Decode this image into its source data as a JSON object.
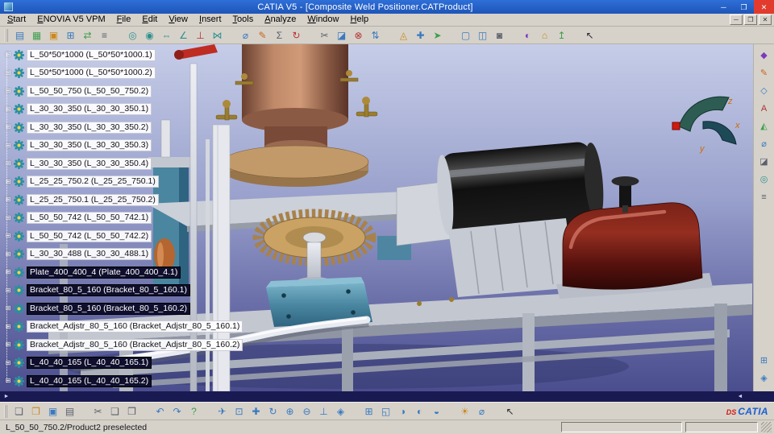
{
  "colors": {
    "titlebar": "#2f6fd8",
    "titlebar-deep": "#1e55b8",
    "close-red": "#e23b2e",
    "chrome": "#d6d2ca",
    "selection-bg": "#0f0f2d",
    "strip-navy": "#1a1a52",
    "logo-blue": "#1a5fd0",
    "logo-red": "#cf1a10",
    "viewport-top": "#c6cde8",
    "viewport-bottom": "#4a4e8e",
    "gear-tan": "#c9a264",
    "mount-teal": "#4a86a0",
    "housing-maroon": "#6b1d17",
    "motor-black": "#141414"
  },
  "window": {
    "title": "CATIA V5 - [Composite Weld Positioner.CATProduct]",
    "controls": [
      {
        "name": "minimize-button",
        "glyph": "─",
        "close": false
      },
      {
        "name": "maximize-button",
        "glyph": "❐",
        "close": false
      },
      {
        "name": "close-button",
        "glyph": "✕",
        "close": true
      }
    ]
  },
  "menu": {
    "items": [
      {
        "name": "menu-start",
        "label": "Start"
      },
      {
        "name": "menu-enovia-v5-vpm",
        "label": "ENOVIA V5 VPM"
      },
      {
        "name": "menu-file",
        "label": "File"
      },
      {
        "name": "menu-edit",
        "label": "Edit"
      },
      {
        "name": "menu-view",
        "label": "View"
      },
      {
        "name": "menu-insert",
        "label": "Insert"
      },
      {
        "name": "menu-tools",
        "label": "Tools"
      },
      {
        "name": "menu-analyze",
        "label": "Analyze"
      },
      {
        "name": "menu-window",
        "label": "Window"
      },
      {
        "name": "menu-help",
        "label": "Help"
      }
    ],
    "doc_controls": [
      {
        "name": "doc-minimize-button",
        "glyph": "─"
      },
      {
        "name": "doc-restore-button",
        "glyph": "❐"
      },
      {
        "name": "doc-close-button",
        "glyph": "✕"
      }
    ]
  },
  "toolbar_top": {
    "icons": [
      {
        "name": "new-component-icon",
        "glyph": "▤",
        "color": "#3a7abe"
      },
      {
        "name": "new-product-icon",
        "glyph": "▦",
        "color": "#3f9e4d"
      },
      {
        "name": "new-part-icon",
        "glyph": "▣",
        "color": "#c9891e"
      },
      {
        "name": "existing-component-icon",
        "glyph": "⊞",
        "color": "#3a7abe"
      },
      {
        "name": "replace-component-icon",
        "glyph": "⇄",
        "color": "#3f9e4d"
      },
      {
        "name": "graph-tree-reorder-icon",
        "glyph": "≡",
        "color": "#5a5f6a"
      },
      {
        "name": "coincidence-constraint-icon",
        "glyph": "◎",
        "color": "#2f8f8f",
        "gap": true
      },
      {
        "name": "contact-constraint-icon",
        "glyph": "◉",
        "color": "#2f8f8f"
      },
      {
        "name": "offset-constraint-icon",
        "glyph": "⇔",
        "color": "#2f8f8f"
      },
      {
        "name": "angle-constraint-icon",
        "glyph": "∠",
        "color": "#2f8f8f"
      },
      {
        "name": "fix-component-icon",
        "glyph": "⊥",
        "color": "#b03030"
      },
      {
        "name": "fix-together-icon",
        "glyph": "⋈",
        "color": "#2f8f8f"
      },
      {
        "name": "measure-between-icon",
        "glyph": "⌀",
        "color": "#3a7abe",
        "gap": true
      },
      {
        "name": "measure-item-icon",
        "glyph": "✎",
        "color": "#c9651e"
      },
      {
        "name": "mass-properties-icon",
        "glyph": "Σ",
        "color": "#5a5f6a"
      },
      {
        "name": "update-all-icon",
        "glyph": "↻",
        "color": "#c03030"
      },
      {
        "name": "trim-cut-icon",
        "glyph": "✂",
        "color": "#5a5f6a",
        "gap": true
      },
      {
        "name": "sectioning-icon",
        "glyph": "◪",
        "color": "#3a7abe"
      },
      {
        "name": "clash-analysis-icon",
        "glyph": "⊗",
        "color": "#b03030"
      },
      {
        "name": "distance-band-icon",
        "glyph": "⇅",
        "color": "#3a7abe"
      },
      {
        "name": "explode-view-icon",
        "glyph": "◬",
        "color": "#c9891e",
        "gap": true
      },
      {
        "name": "manipulate-icon",
        "glyph": "✚",
        "color": "#3a7abe"
      },
      {
        "name": "smart-move-icon",
        "glyph": "➤",
        "color": "#3f9e4d"
      },
      {
        "name": "new-window-icon",
        "glyph": "▢",
        "color": "#3a7abe",
        "gap": true
      },
      {
        "name": "tile-window-icon",
        "glyph": "◫",
        "color": "#3a7abe"
      },
      {
        "name": "capture-image-icon",
        "glyph": "◙",
        "color": "#5a5f6a"
      },
      {
        "name": "render-style-icon",
        "glyph": "◐",
        "color": "#7a3abe",
        "gap": true
      },
      {
        "name": "catalog-browser-icon",
        "glyph": "⌂",
        "color": "#c9891e"
      },
      {
        "name": "publish-icon",
        "glyph": "↥",
        "color": "#3f9e4d"
      },
      {
        "name": "selector-icon",
        "glyph": "↖",
        "color": "#2a2a2a",
        "gap": true
      }
    ]
  },
  "tree": {
    "branch_glyph": "⊞",
    "items": [
      {
        "label": "L_50*50*1000 (L_50*50*1000.1)",
        "selected": false
      },
      {
        "label": "L_50*50*1000 (L_50*50*1000.2)",
        "selected": false
      },
      {
        "label": "L_50_50_750 (L_50_50_750.2)",
        "selected": false
      },
      {
        "label": "L_30_30_350 (L_30_30_350.1)",
        "selected": false
      },
      {
        "label": "L_30_30_350 (L_30_30_350.2)",
        "selected": false
      },
      {
        "label": "L_30_30_350 (L_30_30_350.3)",
        "selected": false
      },
      {
        "label": "L_30_30_350 (L_30_30_350.4)",
        "selected": false
      },
      {
        "label": "L_25_25_750.2 (L_25_25_750.1)",
        "selected": false
      },
      {
        "label": "L_25_25_750.1 (L_25_25_750.2)",
        "selected": false
      },
      {
        "label": "L_50_50_742 (L_50_50_742.1)",
        "selected": false
      },
      {
        "label": "L_50_50_742 (L_50_50_742.2)",
        "selected": false
      },
      {
        "label": "L_30_30_488 (L_30_30_488.1)",
        "selected": false
      },
      {
        "label": "Plate_400_400_4 (Plate_400_400_4.1)",
        "selected": true
      },
      {
        "label": "Bracket_80_5_160 (Bracket_80_5_160.1)",
        "selected": true
      },
      {
        "label": "Bracket_80_5_160 (Bracket_80_5_160.2)",
        "selected": true
      },
      {
        "label": "Bracket_Adjstr_80_5_160 (Bracket_Adjstr_80_5_160.1)",
        "selected": false
      },
      {
        "label": "Bracket_Adjstr_80_5_160 (Bracket_Adjstr_80_5_160.2)",
        "selected": false
      },
      {
        "label": "L_40_40_165 (L_40_40_165.1)",
        "selected": true
      },
      {
        "label": "L_40_40_165 (L_40_40_165.2)",
        "selected": true
      }
    ]
  },
  "viewport": {
    "compass_labels": {
      "x": "x",
      "y": "y",
      "z": "z"
    }
  },
  "toolbar_right": {
    "top": [
      {
        "name": "enovia-icon",
        "glyph": "◆",
        "color": "#7a3abe"
      },
      {
        "name": "sketcher-icon",
        "glyph": "✎",
        "color": "#c9651e"
      },
      {
        "name": "plane-icon",
        "glyph": "◇",
        "color": "#3a7abe"
      },
      {
        "name": "annotation-icon",
        "glyph": "A",
        "color": "#b03030"
      },
      {
        "name": "weld-feature-icon",
        "glyph": "◭",
        "color": "#3f9e4d"
      },
      {
        "name": "measure-icon",
        "glyph": "⌀",
        "color": "#3a7abe"
      },
      {
        "name": "section-view-icon",
        "glyph": "◪",
        "color": "#5a5f6a"
      },
      {
        "name": "constraints-icon",
        "glyph": "◎",
        "color": "#2f8f8f"
      },
      {
        "name": "specification-filter-icon",
        "glyph": "≡",
        "color": "#5a5f6a"
      }
    ],
    "bottom": [
      {
        "name": "four-view-icon",
        "glyph": "⊞",
        "color": "#3a7abe"
      },
      {
        "name": "view-mode-icon",
        "glyph": "◈",
        "color": "#3a7abe"
      }
    ]
  },
  "scroll_strip": {
    "left_glyph": "►",
    "right_glyph": "◄"
  },
  "toolbar_bottom": {
    "icons": [
      {
        "name": "new-file-icon",
        "glyph": "❏",
        "color": "#5a5f6a"
      },
      {
        "name": "open-file-icon",
        "glyph": "❐",
        "color": "#c9891e"
      },
      {
        "name": "save-file-icon",
        "glyph": "▣",
        "color": "#3a7abe"
      },
      {
        "name": "print-icon",
        "glyph": "▤",
        "color": "#5a5f6a"
      },
      {
        "name": "cut-icon",
        "glyph": "✂",
        "color": "#5a5f6a",
        "gap": true
      },
      {
        "name": "copy-icon",
        "glyph": "❑",
        "color": "#5a5f6a"
      },
      {
        "name": "paste-icon",
        "glyph": "❒",
        "color": "#5a5f6a"
      },
      {
        "name": "undo-icon",
        "glyph": "↶",
        "color": "#3a7abe",
        "gap": true
      },
      {
        "name": "redo-icon",
        "glyph": "↷",
        "color": "#3a7abe"
      },
      {
        "name": "whats-this-icon",
        "glyph": "?",
        "color": "#3f9e4d"
      },
      {
        "name": "fly-mode-icon",
        "glyph": "✈",
        "color": "#3a7abe",
        "gap": true
      },
      {
        "name": "fit-all-in-icon",
        "glyph": "⊡",
        "color": "#3a7abe"
      },
      {
        "name": "pan-icon",
        "glyph": "✚",
        "color": "#3a7abe"
      },
      {
        "name": "rotate-view-icon",
        "glyph": "↻",
        "color": "#3a7abe"
      },
      {
        "name": "zoom-in-icon",
        "glyph": "⊕",
        "color": "#3a7abe"
      },
      {
        "name": "zoom-out-icon",
        "glyph": "⊖",
        "color": "#3a7abe"
      },
      {
        "name": "normal-view-icon",
        "glyph": "⊥",
        "color": "#3a7abe"
      },
      {
        "name": "iso-view-icon",
        "glyph": "◈",
        "color": "#3a7abe"
      },
      {
        "name": "multi-view-icon",
        "glyph": "⊞",
        "color": "#3a7abe",
        "gap": true
      },
      {
        "name": "quick-view-icon",
        "glyph": "◱",
        "color": "#3a7abe"
      },
      {
        "name": "shading-mode-icon",
        "glyph": "◑",
        "color": "#3a7abe"
      },
      {
        "name": "hide-show-icon",
        "glyph": "◐",
        "color": "#3a7abe"
      },
      {
        "name": "swap-visible-space-icon",
        "glyph": "◒",
        "color": "#3a7abe"
      },
      {
        "name": "light-effect-icon",
        "glyph": "☀",
        "color": "#c9891e",
        "gap": true
      },
      {
        "name": "measure-quick-icon",
        "glyph": "⌀",
        "color": "#3a7abe"
      },
      {
        "name": "select-tool-icon",
        "glyph": "↖",
        "color": "#2a2a2a",
        "gap": true
      }
    ],
    "logo": {
      "mark": "DS",
      "text": "CATIA"
    }
  },
  "statusbar": {
    "message": "L_50_50_750.2/Product2 preselected"
  }
}
